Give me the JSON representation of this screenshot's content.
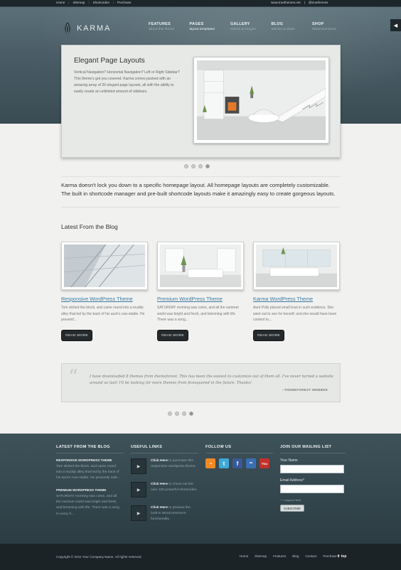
{
  "topbar": {
    "links": [
      "Home",
      "Sitemap",
      "Shortcodes",
      "Purchase"
    ],
    "right": [
      "www.truethemes.net",
      "@truethemes"
    ]
  },
  "logo": {
    "text": "KARMA"
  },
  "nav": [
    {
      "title": "FEATURES",
      "sub": "about this theme"
    },
    {
      "title": "PAGES",
      "sub": "layout templates"
    },
    {
      "title": "GALLERY",
      "sub": "videos & images"
    },
    {
      "title": "BLOG",
      "sub": "articles & ideas"
    },
    {
      "title": "SHOP",
      "sub": "WooCommerce"
    }
  ],
  "slider": {
    "title": "Elegant Page Layouts",
    "text": "Vertical Navigation? Horizontal Navigation? Left or Right Sidebar? This theme's got you covered. Karma comes packed with an amazing array of 20 elegant page layouts, all with the ability to easily create an unlimited amount of sidebars."
  },
  "intro": "Karma doesn't lock you down to a specific homepage layout. All homepage layouts are completely customizable. The built in shortcode manager and pre-built shortcode layouts make it amazingly easy to create gorgeous layouts.",
  "blog": {
    "title": "Latest From the Blog",
    "button": "READ MORE",
    "posts": [
      {
        "title": "Responsive WordPress Theme",
        "excerpt": "Tom skirted the block, and came round into a muddy alley that led by the back of his aunt's cow-stable. He presentl..."
      },
      {
        "title": "Premium WordPress Theme",
        "excerpt": "SATURDAY morning was come, and all the summer world was bright and fresh, and brimming with life. There was a song..."
      },
      {
        "title": "Karma WordPress Theme",
        "excerpt": "Aunt Polly placed small trust in such evidence. She went out to see for herself; and she would have been content to..."
      }
    ]
  },
  "quote": {
    "text": "I have downloaded 8 themes from themeforest. This has been the easiest to customize out of them all. I've never turned a website around so fast! I'll be looking for more themes from ficesquared in the future. Thanks!",
    "author": "~THEMEFOREST MEMBER"
  },
  "footer": {
    "blog": {
      "heading": "LATEST FROM THE BLOG",
      "posts": [
        {
          "title": "RESPONSIVE WORDPRESS THEME",
          "excerpt": "Tom skirted the block, and came round into a muddy alley that led by the back of his aunt's cow-stable. He presently safe..."
        },
        {
          "title": "PREMIUM WORDPRESS THEME",
          "excerpt": "SATURDAY morning was come, and all the summer world was bright and fresh, and brimming with life. There was a song in every h..."
        }
      ]
    },
    "links": {
      "heading": "USEFUL LINKS",
      "items": [
        {
          "bold": "Click Here",
          "text": " to purchase this responsive wordpress theme."
        },
        {
          "bold": "Click Here",
          "text": " to check out the over 100 powerful shortcodes."
        },
        {
          "bold": "Click Here",
          "text": " to preview the built-in WooCommerce functionality."
        }
      ]
    },
    "follow": {
      "heading": "FOLLOW US",
      "icons": [
        {
          "name": "rss-icon",
          "glyph": "◔",
          "color": "#f08a24"
        },
        {
          "name": "twitter-icon",
          "glyph": "t",
          "color": "#3fa9d8"
        },
        {
          "name": "facebook-icon",
          "glyph": "f",
          "color": "#3b5998"
        },
        {
          "name": "flickr-icon",
          "glyph": "••",
          "color": "#3a6fb6"
        },
        {
          "name": "youtube-icon",
          "glyph": "You",
          "color": "#c4302b"
        }
      ]
    },
    "mailing": {
      "heading": "JOIN OUR MAILING LIST",
      "name_label": "Your Name",
      "email_label": "Email Address*",
      "required": "* = required field",
      "button": "SUBSCRIBE"
    }
  },
  "bottom": {
    "copyright": "Copyright © 2011 Your Company Name. All rights reserved.",
    "links": [
      "Home",
      "Sitemap",
      "Features",
      "Blog",
      "Contact",
      "Purchase"
    ],
    "top": "top"
  }
}
